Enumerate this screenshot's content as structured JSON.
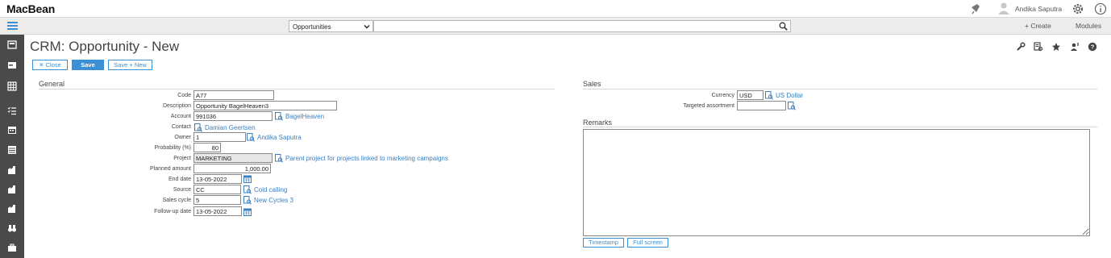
{
  "app": {
    "brand": "MacBean"
  },
  "header": {
    "user_name": "Andika Saputra",
    "create_label": "+ Create",
    "modules_label": "Modules"
  },
  "search": {
    "scope_value": "Opportunities",
    "placeholder": ""
  },
  "page": {
    "title": "CRM: Opportunity - New",
    "close_label": "✕ Close",
    "save_label": "Save",
    "save_new_label": "Save + New"
  },
  "general": {
    "heading": "General",
    "fields": {
      "code": {
        "label": "Code",
        "value": "A77"
      },
      "description": {
        "label": "Description",
        "value": "Opportunity BagelHeaven3"
      },
      "account": {
        "label": "Account",
        "value": "991036",
        "link": "BagelHeaven"
      },
      "contact": {
        "label": "Contact",
        "link": "Damian Geertsen"
      },
      "owner": {
        "label": "Owner",
        "value": "1",
        "link": "Andika Saputra"
      },
      "probability": {
        "label": "Probability (%)",
        "value": "80"
      },
      "project": {
        "label": "Project",
        "value": "MARKETING",
        "link": "Parent project for projects linked to marketing campaigns"
      },
      "planned_amount": {
        "label": "Planned amount",
        "value": "1,000.00"
      },
      "end_date": {
        "label": "End date",
        "value": "13-05-2022"
      },
      "source": {
        "label": "Source",
        "value": "CC",
        "link": "Cold calling"
      },
      "sales_cycle": {
        "label": "Sales cycle",
        "value": "5",
        "link": "New Cycles 3"
      },
      "followup_date": {
        "label": "Follow-up date",
        "value": "13-05-2022"
      }
    }
  },
  "sales": {
    "heading": "Sales",
    "currency": {
      "label": "Currency",
      "value": "USD",
      "link": "US Dollar"
    },
    "assortment": {
      "label": "Targeted assortment",
      "value": ""
    }
  },
  "remarks": {
    "heading": "Remarks",
    "timestamp_label": "Timestamp",
    "fullscreen_label": "Full screen"
  },
  "colors": {
    "accent": "#3b8fd4",
    "sidebar": "#4a4a4a",
    "link": "#3b7fc0"
  }
}
